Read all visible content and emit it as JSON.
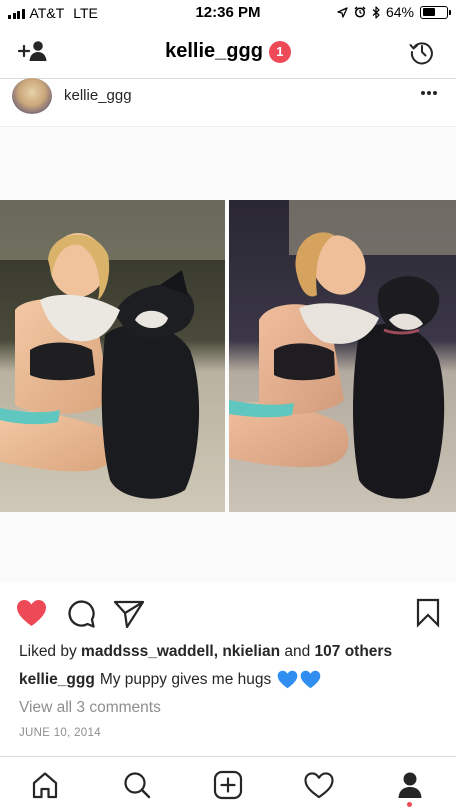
{
  "status_bar": {
    "carrier": "AT&T",
    "network": "LTE",
    "time": "12:36 PM",
    "battery_percent": "64%",
    "battery_level": 0.64,
    "icons": [
      "signal-icon",
      "location-arrow-icon",
      "alarm-icon",
      "bluetooth-icon",
      "battery-icon"
    ]
  },
  "header": {
    "title": "kellie_ggg",
    "notification_count": "1",
    "left_icon": "add-person-icon",
    "right_icon": "history-icon"
  },
  "post": {
    "username": "kellie_ggg",
    "more_icon": "more-dots-icon",
    "likes": {
      "prefix": "Liked by ",
      "users": "maddsss_waddell, nkielian",
      "conjunction": " and ",
      "others": "107 others"
    },
    "caption": {
      "username": "kellie_ggg",
      "text": "My puppy gives me hugs",
      "emoji": "💙💙"
    },
    "view_comments": "View all 3 comments",
    "date": "JUNE 10, 2014",
    "liked": true
  },
  "colors": {
    "like_red": "#ed4956",
    "text": "#262626",
    "muted": "#8e8e8e",
    "divider": "#dbdbdb"
  },
  "tab_bar": [
    "home-icon",
    "search-icon",
    "add-post-icon",
    "activity-heart-icon",
    "profile-icon"
  ]
}
